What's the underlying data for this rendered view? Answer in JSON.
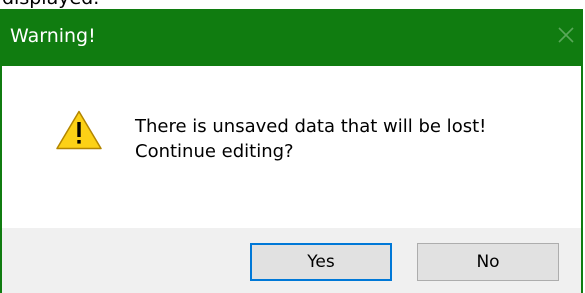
{
  "background_text": "displayed.",
  "dialog": {
    "title": "Warning!",
    "close_glyph": "✕",
    "icon": "warning-triangle-icon",
    "message_lines": [
      "There is unsaved data that will be lost!",
      "Continue editing?"
    ],
    "buttons": {
      "yes_label": "Yes",
      "no_label": "No"
    },
    "colors": {
      "title_bar": "#107c10",
      "title_text": "#ffffff",
      "close_icon": "#5aa85a",
      "button_bar": "#f0f0f0",
      "button_face": "#e1e1e1",
      "focus_border": "#0078d7",
      "warning_fill": "#fcd116"
    }
  }
}
